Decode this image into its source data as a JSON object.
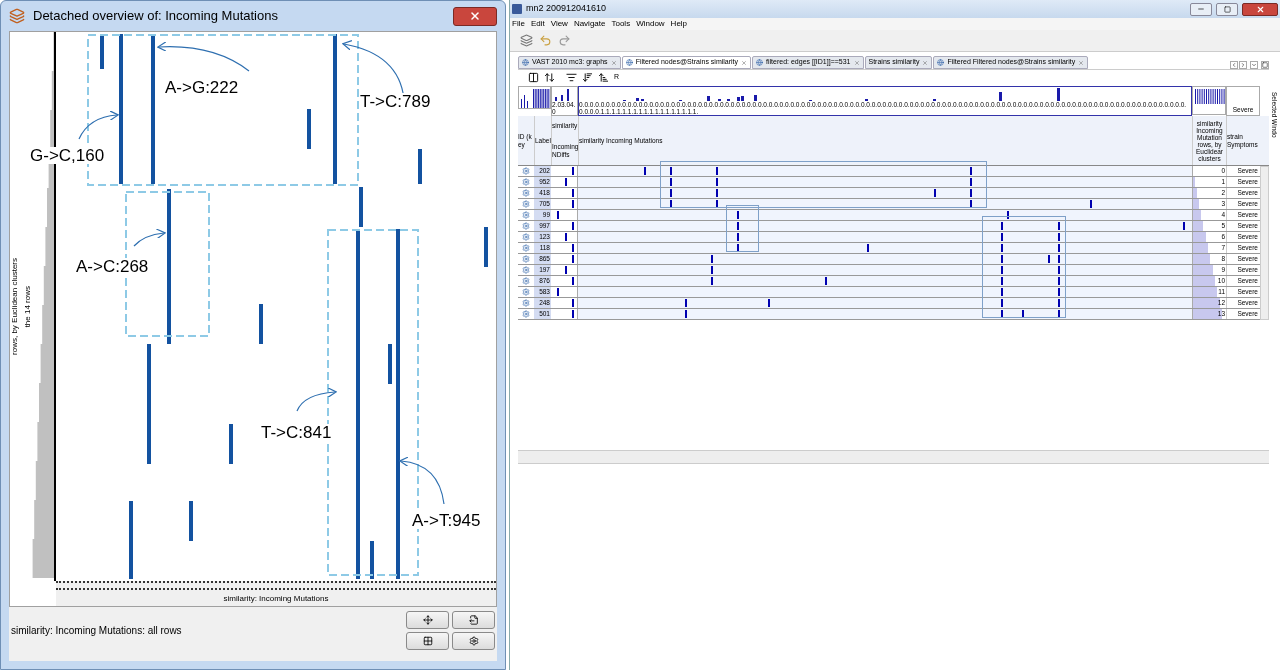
{
  "overview_window": {
    "title": "Detached overview of:  Incoming Mutations",
    "row_axis_label": "rows, by Euclidean clusters",
    "row_axis_sublabel": "the 14 rows",
    "annotations": [
      {
        "text": "A->G:222"
      },
      {
        "text": "T->C:789"
      },
      {
        "text": "G->C,160"
      },
      {
        "text": "A->C:268"
      },
      {
        "text": "T->C:841"
      },
      {
        "text": "A->T:945"
      }
    ],
    "column_axis_label": "similarity: Incoming Mutations",
    "status": "similarity: Incoming Mutations: all rows"
  },
  "main_window": {
    "title": "mn2 200912041610",
    "menu": [
      "File",
      "Edit",
      "View",
      "Navigate",
      "Tools",
      "Window",
      "Help"
    ],
    "tabs": [
      {
        "label": "VAST 2010 mc3: graphs",
        "selected": false
      },
      {
        "label": "Filtered nodes@Strains similarity",
        "selected": true
      },
      {
        "label": "filtered: edges  [[ID1]]==531",
        "selected": false
      },
      {
        "label": "Strains similarity",
        "selected": false
      },
      {
        "label": "Filtered Filtered nodes@Strains similarity",
        "selected": false
      }
    ],
    "toolbar_label": "R",
    "strip": {
      "ndiffs_ticks": "2.03.04.0",
      "mutation_ticks": "0.0.0.0.0.0.0.0.0.0.0.0.0.0.0.0.0.0.0.0.0.0.0.0.0.0.0.0.0.0.0.0.0.0.0.0.0.0.0.0.0.0.0.0.0.0.0.0.0.0.0.0.0.0.0.0.0.0.0.0.0.0.0.0.0.0.0.0.0.0.0.0.0.0.0.0.0.0.0.0.0.0.0.0.0.0.0.0.0.0.0.0.0.0.0.0.0.0.0.0.0.0.0.0.0.0.0.0.0.0.0.0.0.0.0.0.1.1.1.1.1.1.1.1.1.1.1.1.1.1.1.1.1.1.",
      "symptom": "Severe"
    },
    "columns": [
      "ID (key",
      "Label",
      "similarity",
      "Incoming NDiffs",
      "similarity Incoming Mutations",
      "similarity Incoming Mutation rows, by Euclidear clusters",
      "strain Symptoms"
    ],
    "rows": [
      {
        "label": "202",
        "cluster": "0",
        "level": 0,
        "symptom": "Severe"
      },
      {
        "label": "952",
        "cluster": "1",
        "level": 0.06,
        "symptom": "Severe"
      },
      {
        "label": "418",
        "cluster": "2",
        "level": 0.12,
        "symptom": "Severe"
      },
      {
        "label": "705",
        "cluster": "3",
        "level": 0.18,
        "symptom": "Severe"
      },
      {
        "label": "99",
        "cluster": "4",
        "level": 0.24,
        "symptom": "Severe"
      },
      {
        "label": "997",
        "cluster": "5",
        "level": 0.3,
        "symptom": "Severe"
      },
      {
        "label": "123",
        "cluster": "6",
        "level": 0.37,
        "symptom": "Severe"
      },
      {
        "label": "118",
        "cluster": "7",
        "level": 0.43,
        "symptom": "Severe"
      },
      {
        "label": "865",
        "cluster": "8",
        "level": 0.5,
        "symptom": "Severe"
      },
      {
        "label": "197",
        "cluster": "9",
        "level": 0.58,
        "symptom": "Severe"
      },
      {
        "label": "876",
        "cluster": "10",
        "level": 0.64,
        "symptom": "Severe"
      },
      {
        "label": "583",
        "cluster": "11",
        "level": 0.72,
        "symptom": "Severe"
      },
      {
        "label": "248",
        "cluster": "12",
        "level": 0.78,
        "symptom": "Severe"
      },
      {
        "label": "501",
        "cluster": "13",
        "level": 0.86,
        "symptom": "Severe"
      }
    ],
    "side_tab": "Selected Windo"
  }
}
